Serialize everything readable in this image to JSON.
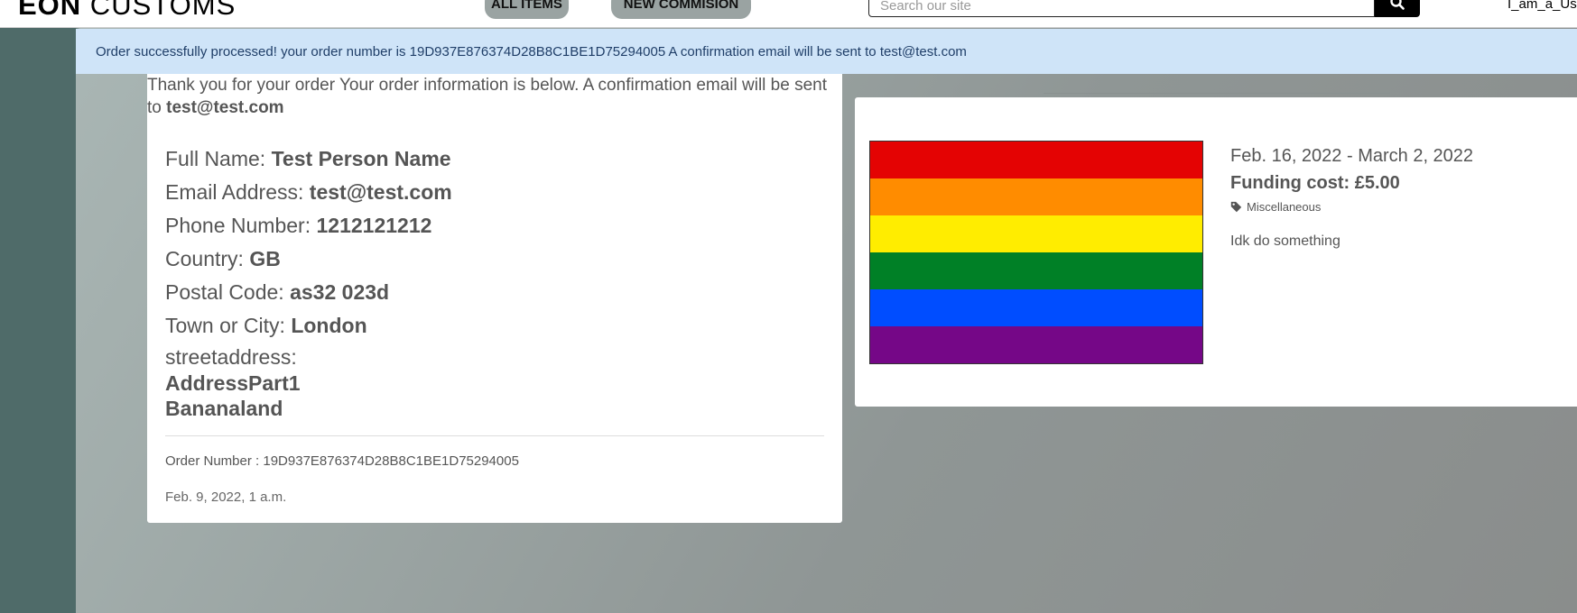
{
  "header": {
    "logo_bold": "EON",
    "logo_rest": " CUSTOMS",
    "nav": [
      {
        "label": "ALL ITEMS"
      },
      {
        "label": "NEW COMMISION"
      }
    ],
    "search_placeholder": "Search our site",
    "user": "I_am_a_User"
  },
  "alert": {
    "message": "Order successfully processed! your order number is 19D937E876374D28B8C1BE1D75294005 A confirmation email will be sent to test@test.com"
  },
  "order": {
    "thanks_text": "Thank you for your order Your order information is below. A confirmation email will be sent to ",
    "thanks_email": "test@test.com",
    "fields": [
      {
        "label": "Full Name: ",
        "value": "Test Person Name"
      },
      {
        "label": "Email Address: ",
        "value": "test@test.com"
      },
      {
        "label": "Phone Number: ",
        "value": "1212121212"
      },
      {
        "label": "Country: ",
        "value": "GB"
      },
      {
        "label": "Postal Code: ",
        "value": "as32 023d"
      },
      {
        "label": "Town or City: ",
        "value": "London"
      }
    ],
    "street_label": "streetaddress:",
    "street_lines": [
      "AddressPart1",
      "Bananaland"
    ],
    "order_number": "Order Number : 19D937E876374D28B8C1BE1D75294005",
    "order_date": "Feb. 9, 2022, 1 a.m."
  },
  "product": {
    "dates": "Feb. 16, 2022 - March 2, 2022",
    "cost": "Funding cost: £5.00",
    "category": "Miscellaneous",
    "category_icon": "tag-icon",
    "description": "Idk do something",
    "flag_colors": [
      "#e40303",
      "#ff8c00",
      "#ffed00",
      "#008026",
      "#004dff",
      "#750787"
    ]
  }
}
